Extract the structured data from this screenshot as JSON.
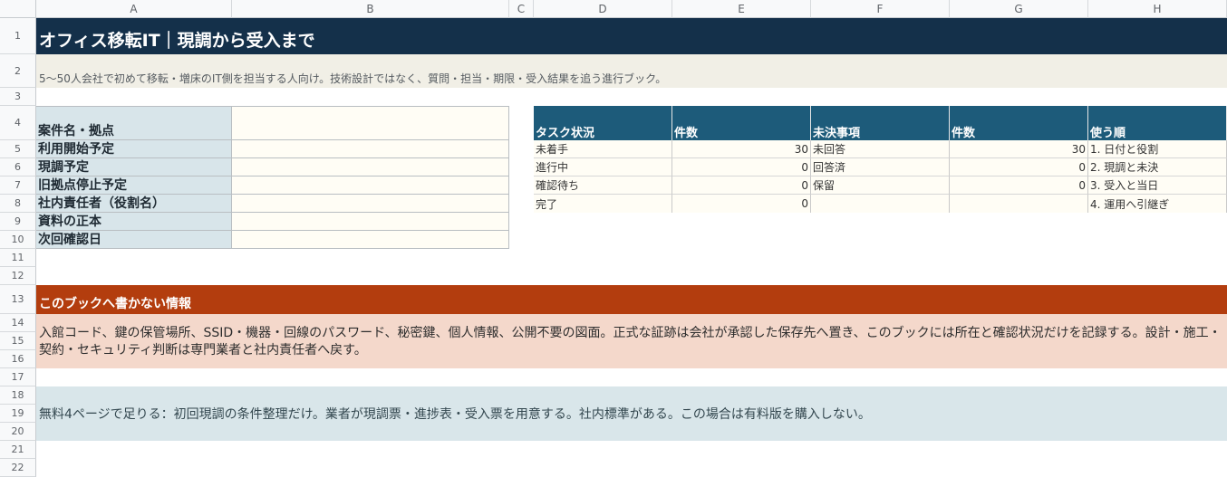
{
  "columns": [
    "A",
    "B",
    "C",
    "D",
    "E",
    "F",
    "G",
    "H"
  ],
  "rows": [
    "1",
    "2",
    "3",
    "4",
    "5",
    "6",
    "7",
    "8",
    "9",
    "10",
    "11",
    "12",
    "13",
    "14",
    "15",
    "16",
    "17",
    "18",
    "19",
    "20",
    "21",
    "22"
  ],
  "title": "オフィス移転IT｜現調から受入まで",
  "subtitle": "5〜50人会社で初めて移転・増床のIT側を担当する人向け。技術設計ではなく、質問・担当・期限・受入結果を追う進行ブック。",
  "info_labels": [
    "案件名・拠点",
    "利用開始予定",
    "現調予定",
    "旧拠点停止予定",
    "社内責任者（役割名）",
    "資料の正本",
    "次回確認日"
  ],
  "status_table": {
    "headers": [
      "タスク状況",
      "件数",
      "未決事項",
      "件数",
      "使う順"
    ],
    "rows": [
      {
        "task": "未着手",
        "task_count": "30",
        "open": "未回答",
        "open_count": "30",
        "order": "1. 日付と役割"
      },
      {
        "task": "進行中",
        "task_count": "0",
        "open": "回答済",
        "open_count": "0",
        "order": "2. 現調と未決"
      },
      {
        "task": "確認待ち",
        "task_count": "0",
        "open": "保留",
        "open_count": "0",
        "order": "3. 受入と当日"
      },
      {
        "task": "完了",
        "task_count": "0",
        "open": "",
        "open_count": "",
        "order": "4. 運用へ引継ぎ"
      }
    ]
  },
  "warning": {
    "header": "このブックへ書かない情報",
    "body": "入館コード、鍵の保管場所、SSID・機器・回線のパスワード、秘密鍵、個人情報、公開不要の図面。正式な証跡は会社が承認した保存先へ置き、このブックには所在と確認状況だけを記録する。設計・施工・契約・セキュリティ判断は専門業者と社内責任者へ戻す。"
  },
  "free_note": "無料4ページで足りる：初回現調の条件整理だけ。業者が現調票・進捗表・受入票を用意する。社内標準がある。この場合は有料版を購入しない。",
  "colors": {
    "title_bg": "#14304a",
    "subtitle_bg": "#f1efe6",
    "label_bg": "#d8e5ea",
    "table_header_bg": "#1d5b7a",
    "warning_header_bg": "#b33d0e",
    "warning_body_bg": "#f4d8cb",
    "free_note_bg": "#d9e6ea"
  }
}
